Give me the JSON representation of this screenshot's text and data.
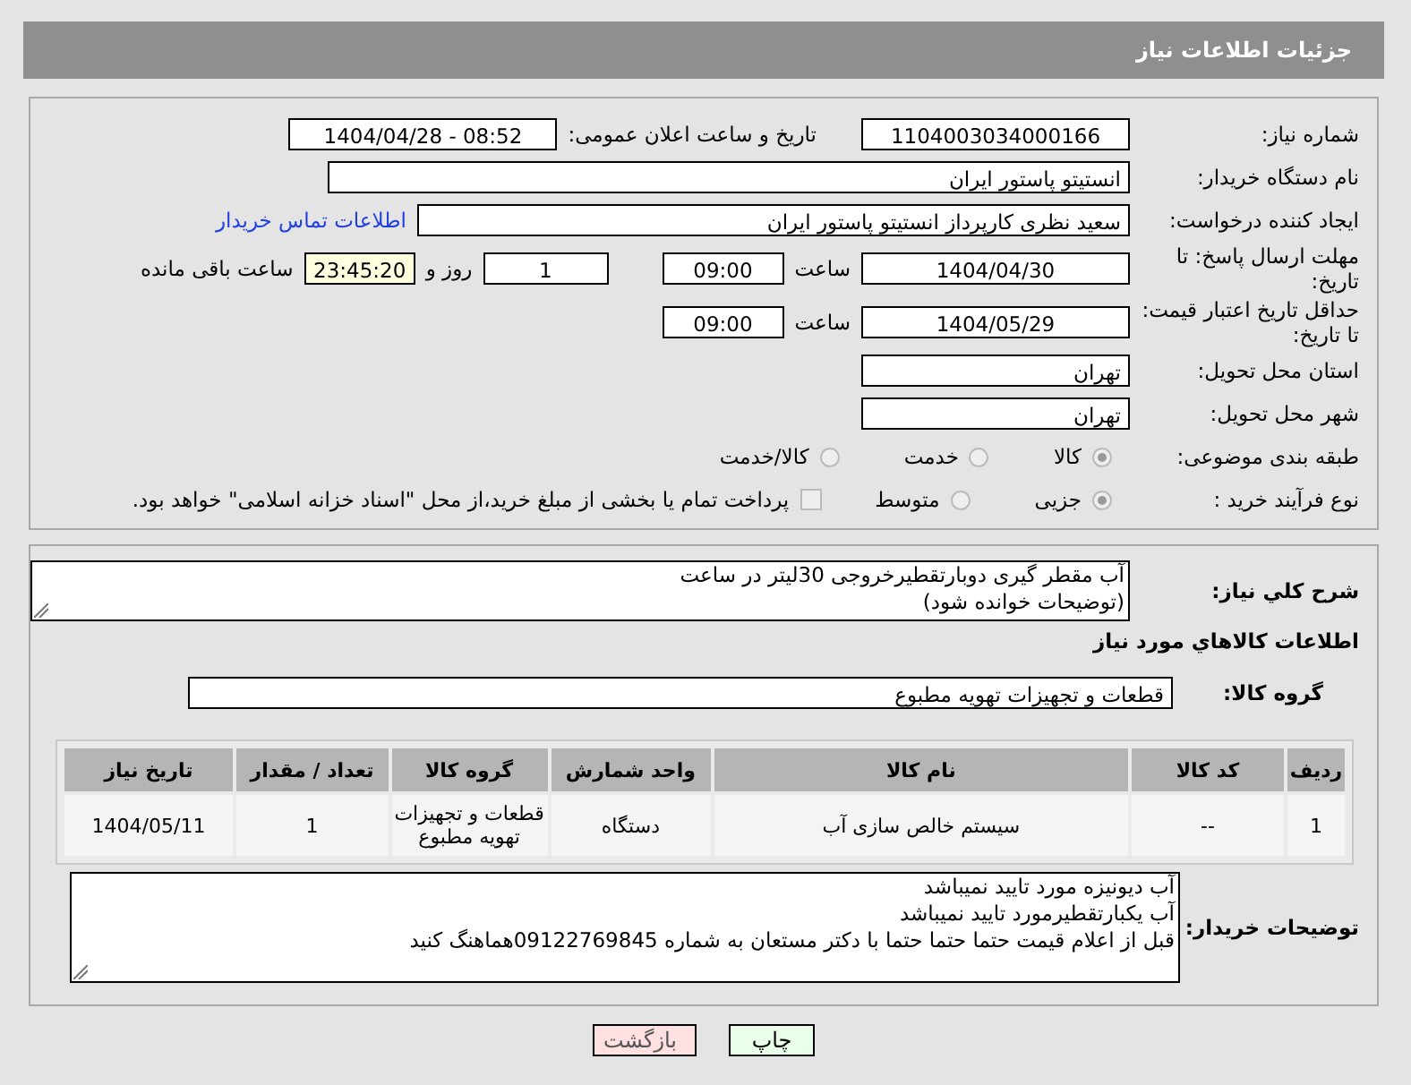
{
  "header": {
    "title": "جزئیات اطلاعات نیاز"
  },
  "details": {
    "need_number": {
      "label": "شماره نیاز:",
      "value": "1104003034000166"
    },
    "announce": {
      "label": "تاریخ و ساعت اعلان عمومی:",
      "value": "1404/04/28 - 08:52"
    },
    "buyer_org": {
      "label": "نام دستگاه خریدار:",
      "value": "انستیتو پاستور ایران"
    },
    "creator": {
      "label": "ایجاد کننده درخواست:",
      "value": "سعید نظری کارپرداز انستیتو پاستور ایران",
      "link": "اطلاعات تماس خریدار"
    },
    "reply_deadline": {
      "label": "مهلت ارسال پاسخ: تا تاریخ:",
      "date": "1404/04/30",
      "time_label": "ساعت",
      "time": "09:00",
      "days": "1",
      "days_label": "روز و",
      "remaining": "23:45:20",
      "remaining_label": "ساعت باقی مانده"
    },
    "price_validity": {
      "label": "حداقل تاریخ اعتبار قیمت: تا تاریخ:",
      "date": "1404/05/29",
      "time_label": "ساعت",
      "time": "09:00"
    },
    "province": {
      "label": "استان محل تحویل:",
      "value": "تهران"
    },
    "city": {
      "label": "شهر محل تحویل:",
      "value": "تهران"
    },
    "category": {
      "label": "طبقه بندی موضوعی:",
      "options": [
        {
          "label": "کالا",
          "selected": true
        },
        {
          "label": "خدمت",
          "selected": false
        },
        {
          "label": "کالا/خدمت",
          "selected": false
        }
      ]
    },
    "process": {
      "label": "نوع فرآیند خرید :",
      "options": [
        {
          "label": "جزیی",
          "selected": true
        },
        {
          "label": "متوسط",
          "selected": false
        }
      ],
      "treasury": {
        "label": "پرداخت تمام یا بخشی از مبلغ خرید،از محل \"اسناد خزانه اسلامی\" خواهد بود.",
        "checked": false
      }
    }
  },
  "goods": {
    "description_label": "شرح کلي نياز:",
    "description_lines": [
      "آب مقطر گیری دوبارتقطیرخروجی 30لیتر در ساعت",
      "(توضیحات خوانده شود)"
    ],
    "title": "اطلاعات کالاهاي مورد نياز",
    "group_label": "گروه کالا:",
    "group": "قطعات و تجهیزات تهویه مطبوع",
    "table": {
      "columns": [
        "ردیف",
        "کد کالا",
        "نام کالا",
        "واحد شمارش",
        "گروه کالا",
        "تعداد / مقدار",
        "تاریخ نیاز"
      ],
      "rows": [
        [
          "1",
          "--",
          "سیستم خالص سازی آب",
          "دستگاه",
          "قطعات و تجهیزات تهویه مطبوع",
          "1",
          "1404/05/11"
        ]
      ]
    },
    "notes_label": "توضیحات خریدار:",
    "notes_lines": [
      "آب دیونیزه مورد تایید نمیباشد",
      "آب یکبارتقطیرمورد تایید نمیباشد",
      "قبل از اعلام قیمت حتما حتما حتما با دکتر مستعان به شماره 09122769845هماهنگ کنید"
    ]
  },
  "buttons": [
    {
      "label": "چاپ",
      "kind": "print"
    },
    {
      "label": "بازگشت",
      "kind": "back"
    }
  ]
}
